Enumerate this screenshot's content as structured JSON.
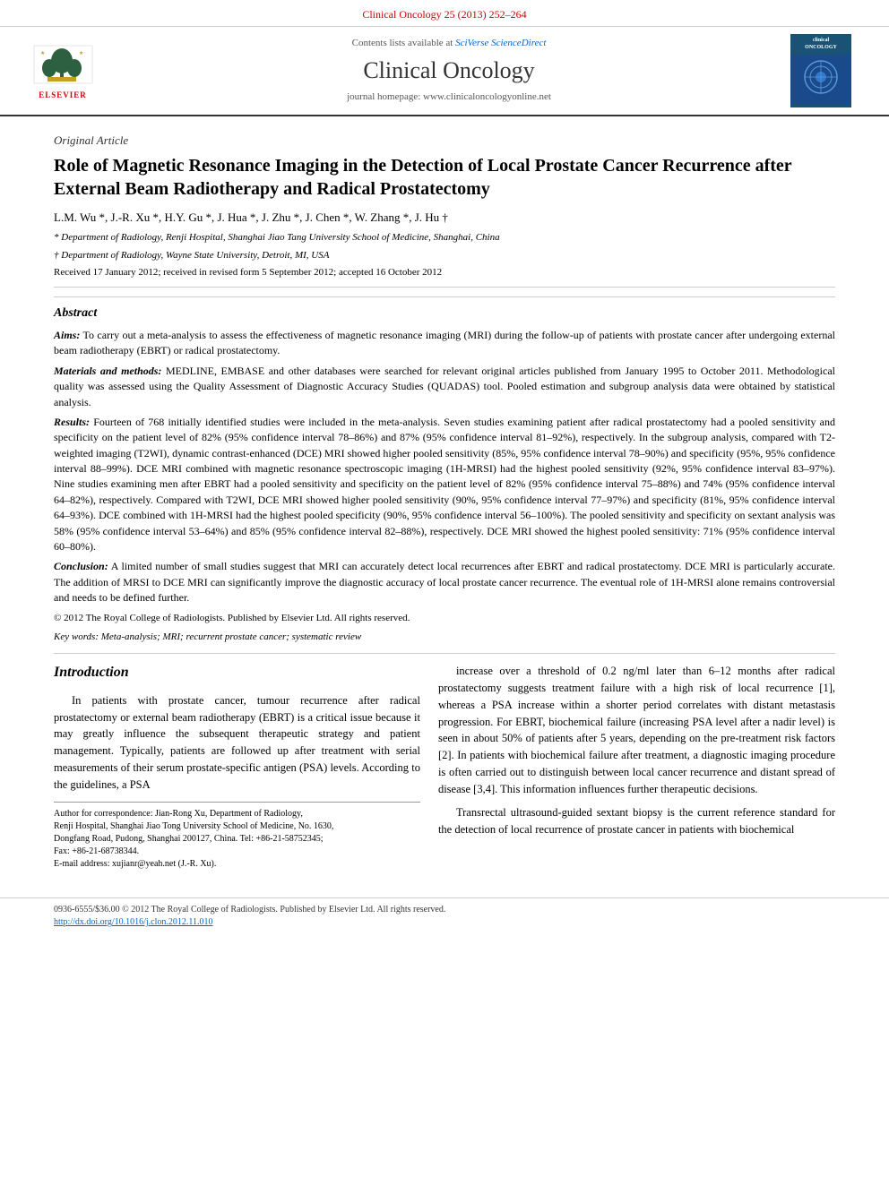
{
  "topbar": {
    "journal_ref": "Clinical Oncology 25 (2013) 252–264"
  },
  "header": {
    "sciverse_text": "Contents lists available at ",
    "sciverse_link": "SciVerse ScienceDirect",
    "journal_title": "Clinical Oncology",
    "homepage_label": "journal homepage: www.clinicaloncologyonline.net",
    "elsevier_label": "ELSEVIER"
  },
  "article": {
    "type": "Original Article",
    "title": "Role of Magnetic Resonance Imaging in the Detection of Local Prostate Cancer Recurrence after External Beam Radiotherapy and Radical Prostatectomy",
    "authors": "L.M. Wu *, J.-R. Xu *, H.Y. Gu *, J. Hua *, J. Zhu *, J. Chen *, W. Zhang *, J. Hu †",
    "affiliation1": "* Department of Radiology, Renji Hospital, Shanghai Jiao Tang University School of Medicine, Shanghai, China",
    "affiliation2": "† Department of Radiology, Wayne State University, Detroit, MI, USA",
    "received": "Received 17 January 2012; received in revised form 5 September 2012; accepted 16 October 2012"
  },
  "abstract": {
    "title": "Abstract",
    "aims_label": "Aims:",
    "aims_text": "To carry out a meta-analysis to assess the effectiveness of magnetic resonance imaging (MRI) during the follow-up of patients with prostate cancer after undergoing external beam radiotherapy (EBRT) or radical prostatectomy.",
    "mm_label": "Materials and methods:",
    "mm_text": "MEDLINE, EMBASE and other databases were searched for relevant original articles published from January 1995 to October 2011. Methodological quality was assessed using the Quality Assessment of Diagnostic Accuracy Studies (QUADAS) tool. Pooled estimation and subgroup analysis data were obtained by statistical analysis.",
    "results_label": "Results:",
    "results_text": "Fourteen of 768 initially identified studies were included in the meta-analysis. Seven studies examining patient after radical prostatectomy had a pooled sensitivity and specificity on the patient level of 82% (95% confidence interval 78–86%) and 87% (95% confidence interval 81–92%), respectively. In the subgroup analysis, compared with T2-weighted imaging (T2WI), dynamic contrast-enhanced (DCE) MRI showed higher pooled sensitivity (85%, 95% confidence interval 78–90%) and specificity (95%, 95% confidence interval 88–99%). DCE MRI combined with magnetic resonance spectroscopic imaging (1H-MRSI) had the highest pooled sensitivity (92%, 95% confidence interval 83–97%). Nine studies examining men after EBRT had a pooled sensitivity and specificity on the patient level of 82% (95% confidence interval 75–88%) and 74% (95% confidence interval 64–82%), respectively. Compared with T2WI, DCE MRI showed higher pooled sensitivity (90%, 95% confidence interval 77–97%) and specificity (81%, 95% confidence interval 64–93%). DCE combined with 1H-MRSI had the highest pooled specificity (90%, 95% confidence interval 56–100%). The pooled sensitivity and specificity on sextant analysis was 58% (95% confidence interval 53–64%) and 85% (95% confidence interval 82–88%), respectively. DCE MRI showed the highest pooled sensitivity: 71% (95% confidence interval 60–80%).",
    "conclusion_label": "Conclusion:",
    "conclusion_text": "A limited number of small studies suggest that MRI can accurately detect local recurrences after EBRT and radical prostatectomy. DCE MRI is particularly accurate. The addition of MRSI to DCE MRI can significantly improve the diagnostic accuracy of local prostate cancer recurrence. The eventual role of 1H-MRSI alone remains controversial and needs to be defined further.",
    "copyright": "© 2012 The Royal College of Radiologists. Published by Elsevier Ltd. All rights reserved.",
    "keywords_label": "Key words:",
    "keywords": "Meta-analysis; MRI; recurrent prostate cancer; systematic review"
  },
  "introduction": {
    "title": "Introduction",
    "para1": "In patients with prostate cancer, tumour recurrence after radical prostatectomy or external beam radiotherapy (EBRT) is a critical issue because it may greatly influence the subsequent therapeutic strategy and patient management. Typically, patients are followed up after treatment with serial measurements of their serum prostate-specific antigen (PSA) levels. According to the guidelines, a PSA",
    "para_right1": "increase over a threshold of 0.2 ng/ml later than 6–12 months after radical prostatectomy suggests treatment failure with a high risk of local recurrence [1], whereas a PSA increase within a shorter period correlates with distant metastasis progression. For EBRT, biochemical failure (increasing PSA level after a nadir level) is seen in about 50% of patients after 5 years, depending on the pre-treatment risk factors [2]. In patients with biochemical failure after treatment, a diagnostic imaging procedure is often carried out to distinguish between local cancer recurrence and distant spread of disease [3,4]. This information influences further therapeutic decisions.",
    "para_right2": "Transrectal ultrasound-guided sextant biopsy is the current reference standard for the detection of local recurrence of prostate cancer in patients with biochemical"
  },
  "footnote": {
    "line1": "Author for correspondence: Jian-Rong Xu, Department of Radiology,",
    "line2": "Renji Hospital, Shanghai Jiao Tong University School of Medicine, No. 1630,",
    "line3": "Dongfang Road, Pudong, Shanghai 200127, China. Tel: +86-21-58752345;",
    "line4": "Fax: +86-21-68738344.",
    "line5": "E-mail address: xujianr@yeah.net (J.-R. Xu)."
  },
  "footer": {
    "issn": "0936-6555/$36.00 © 2012 The Royal College of Radiologists. Published by Elsevier Ltd. All rights reserved.",
    "doi": "http://dx.doi.org/10.1016/j.clon.2012.11.010"
  }
}
